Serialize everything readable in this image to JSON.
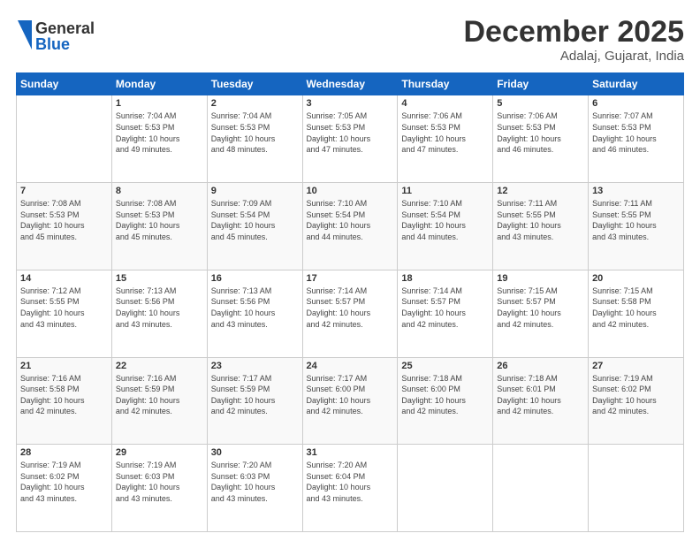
{
  "header": {
    "logo_line1": "General",
    "logo_line2": "Blue",
    "month_title": "December 2025",
    "location": "Adalaj, Gujarat, India"
  },
  "weekdays": [
    "Sunday",
    "Monday",
    "Tuesday",
    "Wednesday",
    "Thursday",
    "Friday",
    "Saturday"
  ],
  "rows": [
    [
      {
        "day": "",
        "info": ""
      },
      {
        "day": "1",
        "info": "Sunrise: 7:04 AM\nSunset: 5:53 PM\nDaylight: 10 hours\nand 49 minutes."
      },
      {
        "day": "2",
        "info": "Sunrise: 7:04 AM\nSunset: 5:53 PM\nDaylight: 10 hours\nand 48 minutes."
      },
      {
        "day": "3",
        "info": "Sunrise: 7:05 AM\nSunset: 5:53 PM\nDaylight: 10 hours\nand 47 minutes."
      },
      {
        "day": "4",
        "info": "Sunrise: 7:06 AM\nSunset: 5:53 PM\nDaylight: 10 hours\nand 47 minutes."
      },
      {
        "day": "5",
        "info": "Sunrise: 7:06 AM\nSunset: 5:53 PM\nDaylight: 10 hours\nand 46 minutes."
      },
      {
        "day": "6",
        "info": "Sunrise: 7:07 AM\nSunset: 5:53 PM\nDaylight: 10 hours\nand 46 minutes."
      }
    ],
    [
      {
        "day": "7",
        "info": "Sunrise: 7:08 AM\nSunset: 5:53 PM\nDaylight: 10 hours\nand 45 minutes."
      },
      {
        "day": "8",
        "info": "Sunrise: 7:08 AM\nSunset: 5:53 PM\nDaylight: 10 hours\nand 45 minutes."
      },
      {
        "day": "9",
        "info": "Sunrise: 7:09 AM\nSunset: 5:54 PM\nDaylight: 10 hours\nand 45 minutes."
      },
      {
        "day": "10",
        "info": "Sunrise: 7:10 AM\nSunset: 5:54 PM\nDaylight: 10 hours\nand 44 minutes."
      },
      {
        "day": "11",
        "info": "Sunrise: 7:10 AM\nSunset: 5:54 PM\nDaylight: 10 hours\nand 44 minutes."
      },
      {
        "day": "12",
        "info": "Sunrise: 7:11 AM\nSunset: 5:55 PM\nDaylight: 10 hours\nand 43 minutes."
      },
      {
        "day": "13",
        "info": "Sunrise: 7:11 AM\nSunset: 5:55 PM\nDaylight: 10 hours\nand 43 minutes."
      }
    ],
    [
      {
        "day": "14",
        "info": "Sunrise: 7:12 AM\nSunset: 5:55 PM\nDaylight: 10 hours\nand 43 minutes."
      },
      {
        "day": "15",
        "info": "Sunrise: 7:13 AM\nSunset: 5:56 PM\nDaylight: 10 hours\nand 43 minutes."
      },
      {
        "day": "16",
        "info": "Sunrise: 7:13 AM\nSunset: 5:56 PM\nDaylight: 10 hours\nand 43 minutes."
      },
      {
        "day": "17",
        "info": "Sunrise: 7:14 AM\nSunset: 5:57 PM\nDaylight: 10 hours\nand 42 minutes."
      },
      {
        "day": "18",
        "info": "Sunrise: 7:14 AM\nSunset: 5:57 PM\nDaylight: 10 hours\nand 42 minutes."
      },
      {
        "day": "19",
        "info": "Sunrise: 7:15 AM\nSunset: 5:57 PM\nDaylight: 10 hours\nand 42 minutes."
      },
      {
        "day": "20",
        "info": "Sunrise: 7:15 AM\nSunset: 5:58 PM\nDaylight: 10 hours\nand 42 minutes."
      }
    ],
    [
      {
        "day": "21",
        "info": "Sunrise: 7:16 AM\nSunset: 5:58 PM\nDaylight: 10 hours\nand 42 minutes."
      },
      {
        "day": "22",
        "info": "Sunrise: 7:16 AM\nSunset: 5:59 PM\nDaylight: 10 hours\nand 42 minutes."
      },
      {
        "day": "23",
        "info": "Sunrise: 7:17 AM\nSunset: 5:59 PM\nDaylight: 10 hours\nand 42 minutes."
      },
      {
        "day": "24",
        "info": "Sunrise: 7:17 AM\nSunset: 6:00 PM\nDaylight: 10 hours\nand 42 minutes."
      },
      {
        "day": "25",
        "info": "Sunrise: 7:18 AM\nSunset: 6:00 PM\nDaylight: 10 hours\nand 42 minutes."
      },
      {
        "day": "26",
        "info": "Sunrise: 7:18 AM\nSunset: 6:01 PM\nDaylight: 10 hours\nand 42 minutes."
      },
      {
        "day": "27",
        "info": "Sunrise: 7:19 AM\nSunset: 6:02 PM\nDaylight: 10 hours\nand 42 minutes."
      }
    ],
    [
      {
        "day": "28",
        "info": "Sunrise: 7:19 AM\nSunset: 6:02 PM\nDaylight: 10 hours\nand 43 minutes."
      },
      {
        "day": "29",
        "info": "Sunrise: 7:19 AM\nSunset: 6:03 PM\nDaylight: 10 hours\nand 43 minutes."
      },
      {
        "day": "30",
        "info": "Sunrise: 7:20 AM\nSunset: 6:03 PM\nDaylight: 10 hours\nand 43 minutes."
      },
      {
        "day": "31",
        "info": "Sunrise: 7:20 AM\nSunset: 6:04 PM\nDaylight: 10 hours\nand 43 minutes."
      },
      {
        "day": "",
        "info": ""
      },
      {
        "day": "",
        "info": ""
      },
      {
        "day": "",
        "info": ""
      }
    ]
  ]
}
